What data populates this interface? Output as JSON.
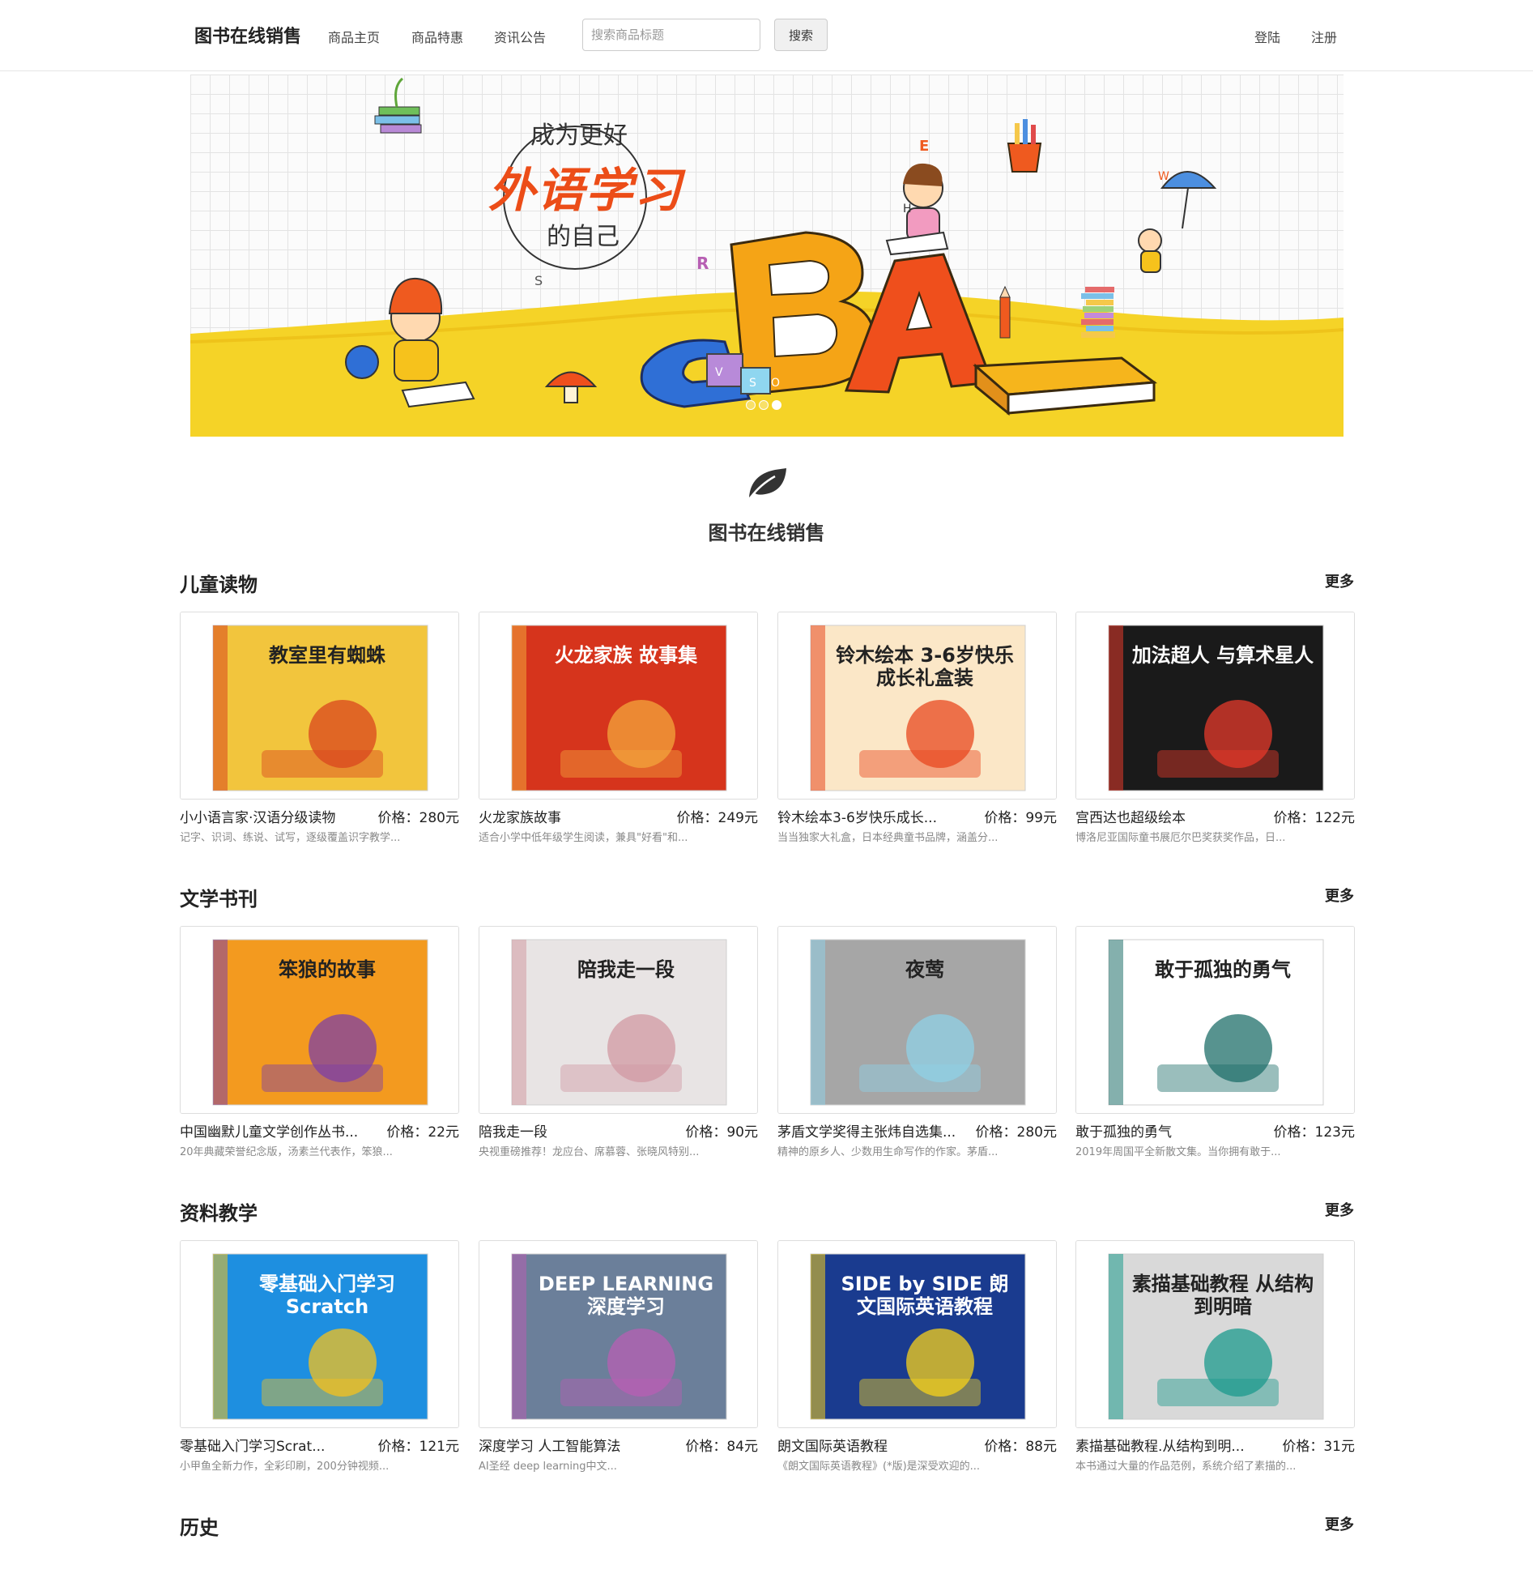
{
  "navbar": {
    "brand": "图书在线销售",
    "links": [
      "商品主页",
      "商品特惠",
      "资讯公告"
    ],
    "search_placeholder": "搜索商品标题",
    "search_button": "搜索",
    "login": "登陆",
    "register": "注册"
  },
  "banner": {
    "slogan_top": "成为更好",
    "slogan_main": "外语学习",
    "slogan_bottom": "的自己",
    "letters": [
      "B",
      "A",
      "C"
    ],
    "small_letters": [
      "E",
      "H",
      "W",
      "R",
      "S",
      "V",
      "S",
      "O"
    ],
    "active_slide": 3,
    "slide_count": 3
  },
  "site_title": "图书在线销售",
  "sections": [
    {
      "title": "儿童读物",
      "more": "更多",
      "items": [
        {
          "name": "小小语言家·汉语分级读物",
          "price": "价格：280元",
          "desc": "记字、识词、练说、试写，逐级覆盖识字教学...",
          "cover_text": "教室里有蜘蛛",
          "cover_bg": "#f2c53d",
          "cover_accent": "#d9451e"
        },
        {
          "name": "火龙家族故事",
          "price": "价格：249元",
          "desc": "适合小学中低年级学生阅读，兼具\"好看\"和...",
          "cover_text": "火龙家族 故事集",
          "cover_bg": "#d6341c",
          "cover_accent": "#f3a53b"
        },
        {
          "name": "铃木绘本3-6岁快乐成长...",
          "price": "价格：99元",
          "desc": "当当独家大礼盒，日本经典童书品牌，涵盖分...",
          "cover_text": "铃木绘本 3-6岁快乐成长礼盒装",
          "cover_bg": "#fbe7c7",
          "cover_accent": "#e8481f"
        },
        {
          "name": "宫西达也超级绘本",
          "price": "价格：122元",
          "desc": "博洛尼亚国际童书展厄尔巴奖获奖作品，日...",
          "cover_text": "加法超人 与算术星人",
          "cover_bg": "#1a1a1a",
          "cover_accent": "#e63a2b"
        }
      ]
    },
    {
      "title": "文学书刊",
      "more": "更多",
      "items": [
        {
          "name": "中国幽默儿童文学创作丛书...",
          "price": "价格：22元",
          "desc": "20年典藏荣誉纪念版，汤素兰代表作，笨狼...",
          "cover_text": "笨狼的故事",
          "cover_bg": "#f39a1f",
          "cover_accent": "#7d3fa6"
        },
        {
          "name": "陪我走一段",
          "price": "价格：90元",
          "desc": "央视重磅推荐！龙应台、席慕蓉、张晓风特别...",
          "cover_text": "陪我走一段",
          "cover_bg": "#e8e4e4",
          "cover_accent": "#d19aa3"
        },
        {
          "name": "茅盾文学奖得主张炜自选集...",
          "price": "价格：280元",
          "desc": "精神的原乡人、少数用生命写作的作家。茅盾...",
          "cover_text": "夜莺",
          "cover_bg": "#a6a6a6",
          "cover_accent": "#8fd0e6"
        },
        {
          "name": "敢于孤独的勇气",
          "price": "价格：123元",
          "desc": "2019年周国平全新散文集。当你拥有敢于...",
          "cover_text": "敢于孤独的勇气",
          "cover_bg": "#ffffff",
          "cover_accent": "#1f6f6a"
        }
      ]
    },
    {
      "title": "资料教学",
      "more": "更多",
      "items": [
        {
          "name": "零基础入门学习Scrat...",
          "price": "价格：121元",
          "desc": "小甲鱼全新力作，全彩印刷，200分钟视频...",
          "cover_text": "零基础入门学习 Scratch",
          "cover_bg": "#1e8fe0",
          "cover_accent": "#f6c21c"
        },
        {
          "name": "深度学习 人工智能算法",
          "price": "价格：84元",
          "desc": "AI圣经 deep learning中文...",
          "cover_text": "DEEP LEARNING 深度学习",
          "cover_bg": "#6b7f9a",
          "cover_accent": "#b75fb3"
        },
        {
          "name": "朗文国际英语教程",
          "price": "价格：88元",
          "desc": "《朗文国际英语教程》(*版)是深受欢迎的...",
          "cover_text": "SIDE by SIDE 朗文国际英语教程",
          "cover_bg": "#1a3b8f",
          "cover_accent": "#f7d21a"
        },
        {
          "name": "素描基础教程.从结构到明...",
          "price": "价格：31元",
          "desc": "本书通过大量的作品范例，系统介绍了素描的...",
          "cover_text": "素描基础教程 从结构到明暗",
          "cover_bg": "#d9d9d9",
          "cover_accent": "#1b9a8c"
        }
      ]
    },
    {
      "title": "历史",
      "more": "更多",
      "items": []
    }
  ]
}
